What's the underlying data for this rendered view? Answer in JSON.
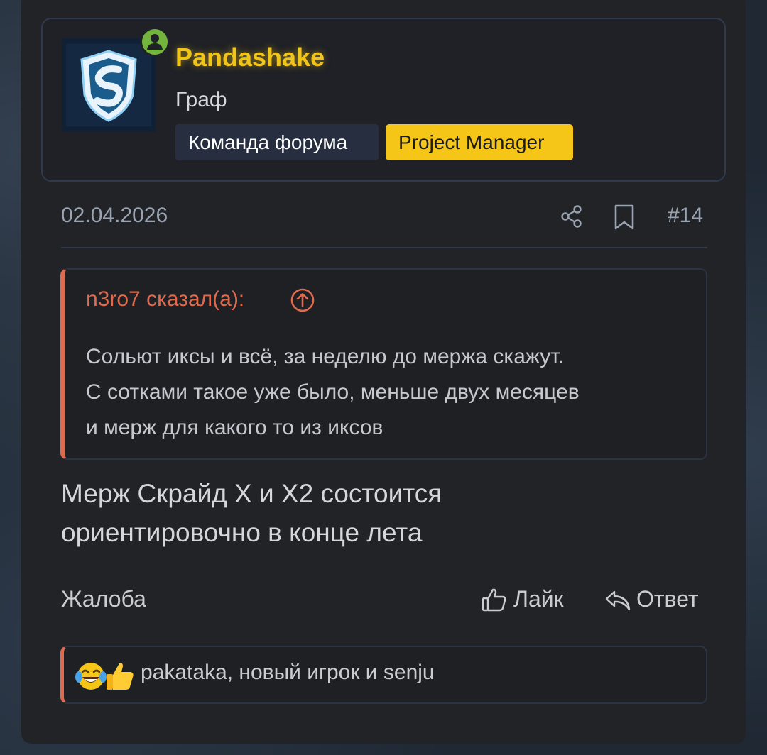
{
  "colors": {
    "username": "#f0c419",
    "badge_pm": "#f5c518",
    "badge_team": "#262e3f",
    "quote_accent": "#e06a4e",
    "online": "#72b43c",
    "muted_text": "#9aa3b2"
  },
  "user": {
    "name": "Pandashake",
    "title": "Граф",
    "online_icon": "user-online-icon",
    "badges": [
      {
        "label": "Команда форума"
      },
      {
        "label": "Project Manager"
      }
    ]
  },
  "post": {
    "date": "02.04.2026",
    "number": "#14",
    "share_icon": "share-icon",
    "bookmark_icon": "bookmark-icon",
    "quote": {
      "author": "n3ro7 сказал(а):",
      "lines": [
        "Сольют иксы и всё, за неделю до мержа скажут.",
        "С сотками такое уже было, меньше двух месяцев",
        "и мерж для какого то из иксов"
      ]
    },
    "message": [
      "Мерж Скрайд X и X2 состоится",
      "ориентировочно в конце лета"
    ]
  },
  "actions": {
    "report": "Жалоба",
    "like": "Лайк",
    "reply": "Ответ"
  },
  "reactions": {
    "emojis": [
      "laughing-crying-emoji",
      "thumbs-up-emoji"
    ],
    "users": "pakataka, новый игрок и senju"
  }
}
